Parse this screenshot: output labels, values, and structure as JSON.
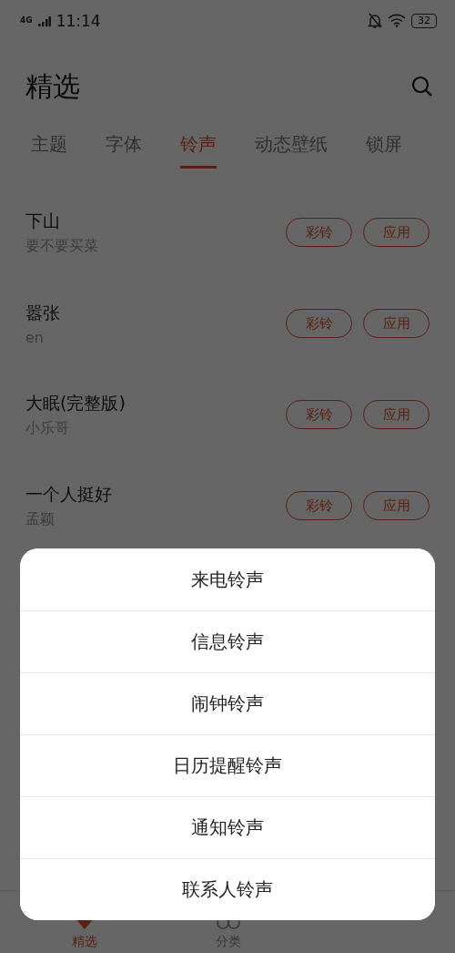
{
  "status_bar": {
    "network": "4G",
    "time": "11:14",
    "battery": "32"
  },
  "header": {
    "title": "精选"
  },
  "tabs": [
    {
      "label": "主题",
      "selected": false
    },
    {
      "label": "字体",
      "selected": false
    },
    {
      "label": "铃声",
      "selected": true
    },
    {
      "label": "动态壁纸",
      "selected": false
    },
    {
      "label": "锁屏",
      "selected": false
    }
  ],
  "songs": [
    {
      "title": "下山",
      "artist": "要不要买菜",
      "buttons": [
        "彩铃",
        "应用"
      ]
    },
    {
      "title": "嚣张",
      "artist": "en",
      "buttons": [
        "彩铃",
        "应用"
      ]
    },
    {
      "title": "大眠(完整版)",
      "artist": "小乐哥",
      "buttons": [
        "彩铃",
        "应用"
      ]
    },
    {
      "title": "一个人挺好",
      "artist": "孟颖",
      "buttons": [
        "彩铃",
        "应用"
      ]
    }
  ],
  "action_sheet": {
    "items": [
      "来电铃声",
      "信息铃声",
      "闹钟铃声",
      "日历提醒铃声",
      "通知铃声",
      "联系人铃声"
    ]
  },
  "bottom_nav": [
    {
      "label": "精选",
      "kind": "featured",
      "selected": true
    },
    {
      "label": "分类",
      "kind": "category",
      "selected": false
    }
  ]
}
